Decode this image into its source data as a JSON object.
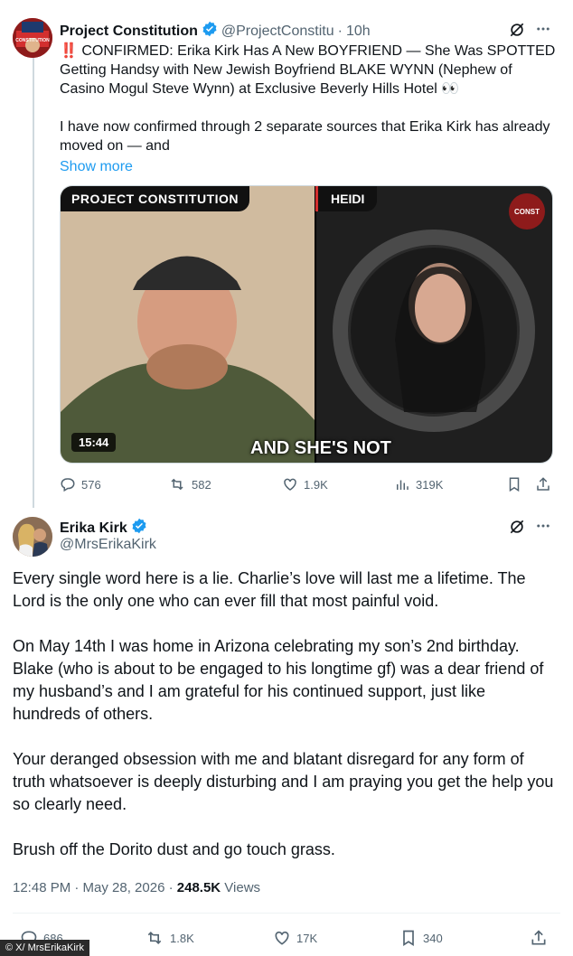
{
  "tweet1": {
    "name": "Project Constitution",
    "handle": "@ProjectConstitu",
    "sep": "·",
    "time": "10h",
    "avatar_text": "CONSTITUTION",
    "text_line1": "‼️ CONFIRMED: Erika Kirk Has A New BOYFRIEND — She Was SPOTTED Getting Handsy with New Jewish Boyfriend BLAKE WYNN (Nephew of Casino Mogul Steve Wynn) at Exclusive Beverly Hills Hotel 👀",
    "text_line2": "I have now confirmed through 2 separate sources that Erika Kirk has already moved on — and",
    "show_more": "Show more",
    "media": {
      "left_label": "PROJECT CONSTITUTION",
      "right_label": "HEIDI",
      "duration": "15:44",
      "caption": "AND SHE'S NOT",
      "logo_text": "CONST"
    },
    "stats": {
      "replies": "576",
      "reposts": "582",
      "likes": "1.9K",
      "views": "319K"
    }
  },
  "tweet2": {
    "name": "Erika Kirk",
    "handle": "@MrsErikaKirk",
    "paragraphs": [
      "Every single word here is a lie. Charlie’s love will last me a lifetime. The Lord is the only one who can ever fill that most painful void.",
      "On May 14th I was home in Arizona celebrating my son’s 2nd birthday. Blake (who is about to be engaged to his longtime gf) was a dear friend of my husband’s and I am grateful for his continued support, just like hundreds of others.",
      "Your deranged obsession with me and blatant disregard for any form of truth whatsoever is deeply disturbing and I am praying you get the help you so clearly need.",
      "Brush off the Dorito dust and go touch grass."
    ],
    "meta_time": "12:48 PM · May 28, 2026 · ",
    "meta_views": "248.5K",
    "meta_views_label": " Views",
    "stats": {
      "replies": "686",
      "reposts": "1.8K",
      "likes": "17K",
      "bookmarks": "340"
    }
  },
  "credit": "© X/ MrsErikaKirk",
  "colors": {
    "link": "#1d9bf0",
    "verified": "#1d9bf0",
    "muted": "#536471"
  }
}
